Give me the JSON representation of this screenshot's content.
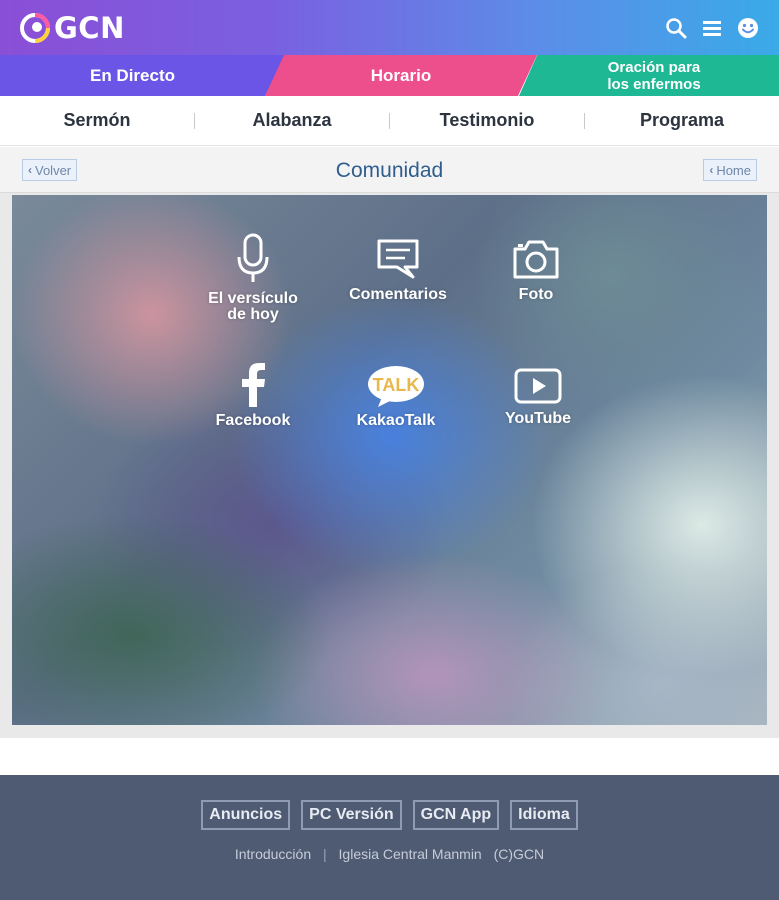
{
  "header": {
    "logo_text": "GCN",
    "icons": [
      "search-icon",
      "menu-icon",
      "smiley-icon"
    ],
    "gradient_colors": [
      "#8a4fd6",
      "#3aaae8"
    ]
  },
  "top_tabs": [
    {
      "label": "En Directo",
      "color": "#6a55e6"
    },
    {
      "label": "Horario",
      "color": "#ec4f8b"
    },
    {
      "label": "Oración para los enfermos",
      "color": "#1fb895"
    }
  ],
  "sub_nav": [
    "Sermón",
    "Alabanza",
    "Testimonio",
    "Programa"
  ],
  "title_bar": {
    "back_label": "Volver",
    "title": "Comunidad",
    "home_label": "Home"
  },
  "community": {
    "items": [
      {
        "label": "El versículo de hoy",
        "icon": "microphone-icon"
      },
      {
        "label": "Comentarios",
        "icon": "comment-icon"
      },
      {
        "label": "Foto",
        "icon": "camera-icon"
      },
      {
        "label": "Facebook",
        "icon": "facebook-icon"
      },
      {
        "label": "KakaoTalk",
        "icon": "kakaotalk-icon",
        "icon_text": "TALK"
      },
      {
        "label": "YouTube",
        "icon": "youtube-icon"
      }
    ]
  },
  "footer": {
    "buttons": [
      "Anuncios",
      "PC Versión",
      "GCN App",
      "Idioma"
    ],
    "links": [
      "Introducción",
      "Iglesia Central Manmin",
      "(C)GCN"
    ],
    "background": "#4f5b73"
  }
}
